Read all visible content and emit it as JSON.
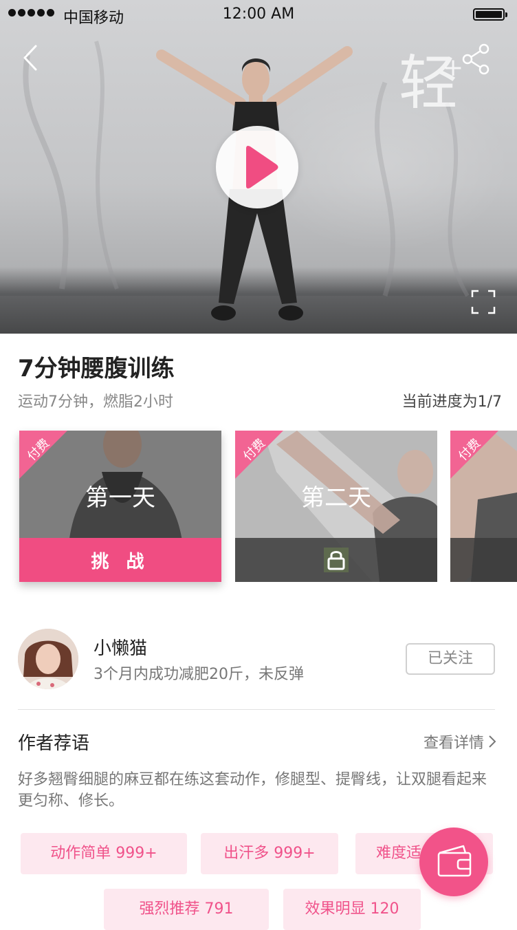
{
  "statusbar": {
    "carrier": "中国移动",
    "time": "12:00 AM"
  },
  "video": {
    "brand_char": "轻",
    "brand_plus": "+"
  },
  "program": {
    "title": "7分钟腰腹训练",
    "subtitle": "运动7分钟，燃脂2小时",
    "progress": "当前进度为1/7"
  },
  "days": [
    {
      "badge": "付费",
      "label": "第一天",
      "action": "挑 战"
    },
    {
      "badge": "付费",
      "label": "第二天"
    },
    {
      "badge": "付费"
    }
  ],
  "author": {
    "name": "小懒猫",
    "desc": "3个月内成功减肥20斤，未反弹",
    "follow_label": "已关注"
  },
  "recommend": {
    "title": "作者荐语",
    "more": "查看详情",
    "text": "好多翘臀细腿的麻豆都在练这套动作，修腿型、提臀线，让双腿看起来更匀称、修长。"
  },
  "tags": [
    "动作简单 999+",
    "出汗多 999+",
    "难度适",
    "强烈推荐 791",
    "效果明显 120"
  ],
  "colors": {
    "accent": "#f04d82",
    "tag_bg": "#fde8ef"
  },
  "icons": [
    "back-icon",
    "share-icon",
    "play-icon",
    "fullscreen-icon",
    "lock-icon",
    "wallet-icon",
    "chevron-right-icon"
  ]
}
